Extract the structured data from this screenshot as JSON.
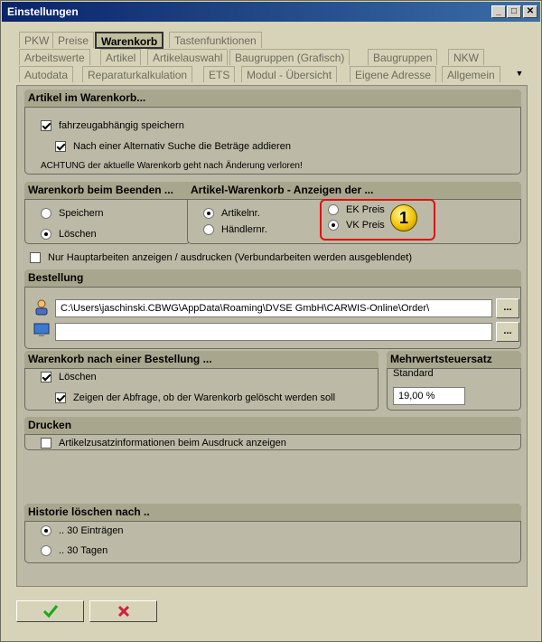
{
  "window": {
    "title": "Einstellungen"
  },
  "tabs": {
    "row1": [
      "PKW",
      "Preise",
      "Warenkorb",
      "Tastenfunktionen"
    ],
    "row2": [
      "Arbeitswerte",
      "Artikel",
      "Artikelauswahl",
      "Baugruppen (Grafisch)",
      "Baugruppen",
      "NKW"
    ],
    "row3": [
      "Autodata",
      "Reparaturkalkulation",
      "ETS",
      "Modul - Übersicht",
      "Eigene Adresse",
      "Allgemein"
    ],
    "active": "Warenkorb"
  },
  "artikel_warenkorb": {
    "title": "Artikel im Warenkorb...",
    "opt1": "fahrzeugabhängig speichern",
    "opt2": "Nach einer Alternativ Suche die Beträge addieren",
    "warning": "ACHTUNG der aktuelle Warenkorb geht nach Änderung verloren!"
  },
  "beenden": {
    "title": "Warenkorb beim Beenden ...",
    "opt_save": "Speichern",
    "opt_delete": "Löschen"
  },
  "anzeigen": {
    "title": "Artikel-Warenkorb - Anzeigen der ...",
    "opt_artnr": "Artikelnr.",
    "opt_haendler": "Händlernr.",
    "opt_ek": "EK Preis",
    "opt_vk": "VK Preis",
    "badge": "1"
  },
  "hauptarbeiten": {
    "label": "Nur Hauptarbeiten anzeigen / ausdrucken (Verbundarbeiten werden ausgeblendet)"
  },
  "bestellung": {
    "title": "Bestellung",
    "path1": "C:\\Users\\jaschinski.CBWG\\AppData\\Roaming\\DVSE GmbH\\CARWIS-Online\\Order\\",
    "path2": "",
    "browse_label": "..."
  },
  "nach_bestellung": {
    "title": "Warenkorb nach einer Bestellung ...",
    "opt_delete": "Löschen",
    "opt_show": "Zeigen der Abfrage, ob der Warenkorb gelöscht werden soll"
  },
  "mwst": {
    "title": "Mehrwertsteuersatz",
    "label": "Standard",
    "value": "19,00  %"
  },
  "drucken": {
    "title": "Drucken",
    "opt": "Artikelzusatzinformationen beim Ausdruck anzeigen"
  },
  "historie": {
    "title": "Historie löschen nach ..",
    "opt1": ".. 30 Einträgen",
    "opt2": ".. 30 Tagen"
  },
  "colors": {
    "ok": "#1aa81a",
    "cancel": "#d02040",
    "highlight": "#e01010",
    "badge": "#f3c400"
  }
}
